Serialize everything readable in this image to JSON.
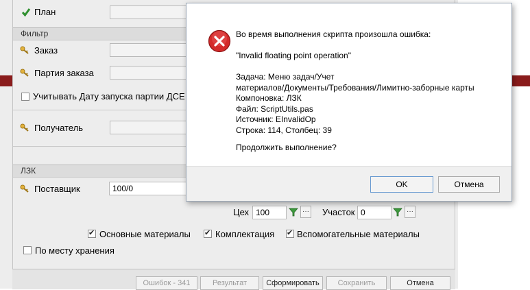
{
  "form": {
    "plan_label": "План",
    "filter_header": "Фильтр",
    "order_label": "Заказ",
    "order_batch_label": "Партия заказа",
    "consider_date_label": "Учитывать Дату запуска партии ДСЕ (",
    "recipient_label": "Получатель",
    "lzk_header": "ЛЗК",
    "supplier_label": "Поставщик",
    "supplier_value": "100/0",
    "workshop_label": "Цех",
    "workshop_value": "100",
    "section_label": "Участок",
    "section_value": "0",
    "main_materials_label": "Основные материалы",
    "kit_label": "Комплектация",
    "aux_materials_label": "Вспомогательные материалы",
    "storage_label": "По месту хранения",
    "checks": {
      "consider_date": false,
      "main_materials": true,
      "kit": true,
      "aux_materials": true,
      "storage": false
    },
    "bottom_buttons": [
      "Ошибок - 341",
      "Результат",
      "Сформировать",
      "Сохранить",
      "Отмена"
    ]
  },
  "dialog": {
    "icon": "error-icon",
    "message": [
      "Во время выполнения скрипта произошла ошибка:",
      "",
      "\"Invalid floating point operation\"",
      "",
      "Задача: Меню задач/Учет",
      "материалов/Документы/Требования/Лимитно-заборные карты",
      "Компоновка: ЛЗК",
      "Файл: ScriptUtils.pas",
      "Источник: EInvalidOp",
      "Строка: 114, Столбец: 39",
      "",
      "Продолжить выполнение?"
    ],
    "ok_label": "OK",
    "cancel_label": "Отмена"
  },
  "colors": {
    "error_red": "#d42a2a",
    "band_red": "#8a1c1c",
    "dialog_border": "#9aa6b5",
    "key_icon": "#e3b23c",
    "check_green": "#2f8f2f"
  }
}
